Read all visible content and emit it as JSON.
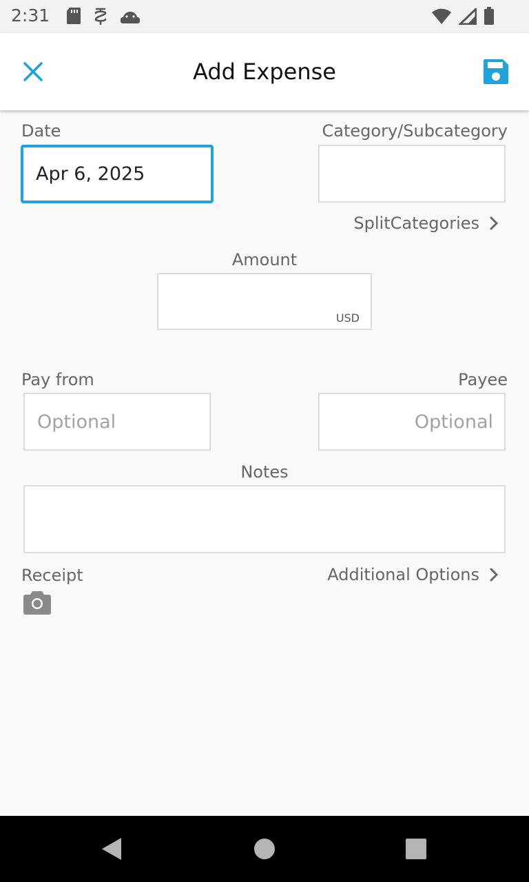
{
  "status_bar": {
    "time": "2:31",
    "left_icons": [
      "sd-card-icon",
      "wired-icon",
      "android-icon"
    ],
    "right_icons": [
      "wifi-icon",
      "signal-icon",
      "battery-icon"
    ]
  },
  "app_bar": {
    "title": "Add Expense",
    "close_icon": "close-icon",
    "save_icon": "save-icon",
    "accent": "#1ea3dc"
  },
  "form": {
    "date_label": "Date",
    "date_value": "Apr 6, 2025",
    "category_label": "Category/Subcategory",
    "category_value": "",
    "split_categories": "SplitCategories",
    "amount_label": "Amount",
    "amount_value": "",
    "currency": "USD",
    "pay_from_label": "Pay from",
    "pay_from_placeholder": "Optional",
    "payee_label": "Payee",
    "payee_placeholder": "Optional",
    "notes_label": "Notes",
    "notes_value": "",
    "receipt_label": "Receipt",
    "receipt_icon": "camera-icon",
    "additional_options": "Additional Options"
  },
  "nav_bar": {
    "buttons": [
      "back-icon",
      "home-icon",
      "recents-icon"
    ]
  }
}
